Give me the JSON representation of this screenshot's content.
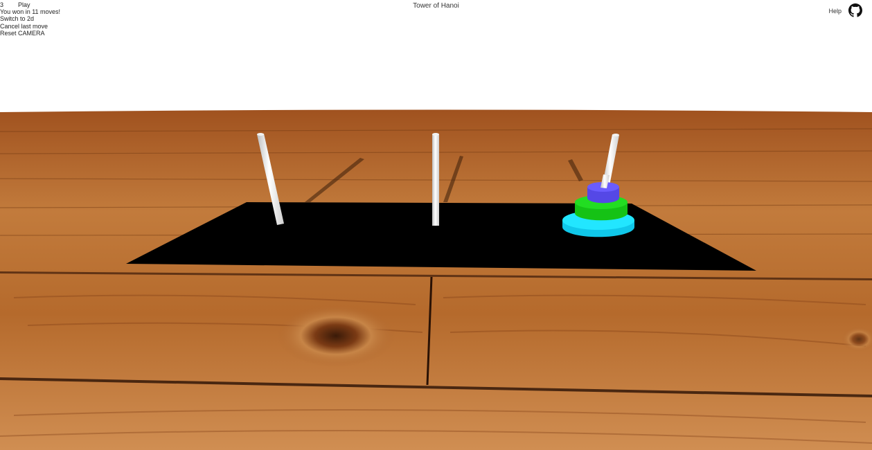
{
  "header": {
    "title": "Tower of Hanoi",
    "help_label": "Help",
    "github_icon": "github-icon"
  },
  "menu": {
    "disk_count": "3",
    "play_label": "Play",
    "status": "You won in 11 moves!",
    "switch_label": "Switch to 2d",
    "cancel_label": "Cancel last move",
    "reset_label": "Reset CAMERA"
  },
  "game": {
    "pegs": 3,
    "disks_on_peg": [
      [],
      [],
      [
        3,
        2,
        1
      ]
    ],
    "disk_colors": {
      "1": "#6a5cff",
      "2": "#22dd22",
      "3": "#22e6ff"
    }
  }
}
